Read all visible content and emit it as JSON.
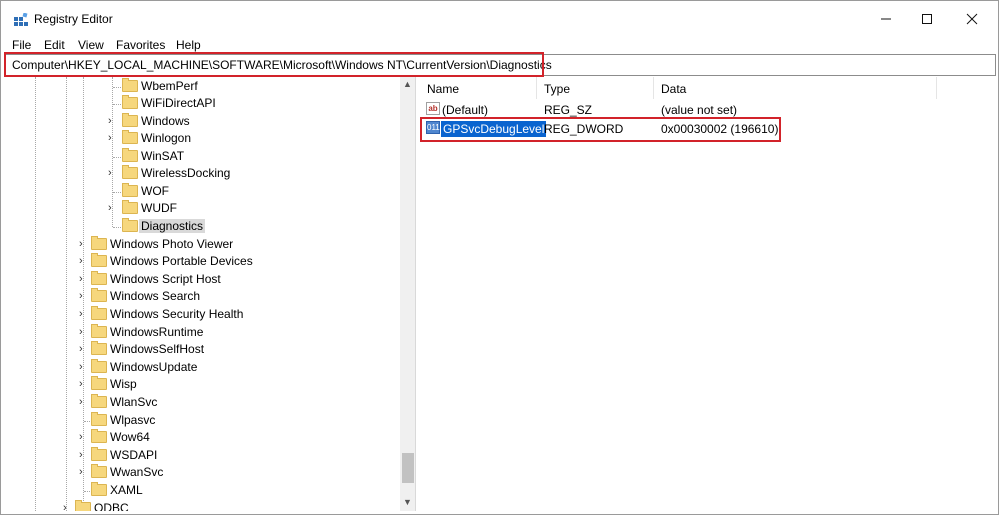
{
  "window": {
    "title": "Registry Editor"
  },
  "title_controls": {
    "minimize": "—",
    "maximize": "☐",
    "close": "✕"
  },
  "menu": [
    "File",
    "Edit",
    "View",
    "Favorites",
    "Help"
  ],
  "address": "Computer\\HKEY_LOCAL_MACHINE\\SOFTWARE\\Microsoft\\Windows NT\\CurrentVersion\\Diagnostics",
  "tree_items": [
    {
      "label": "WbemPerf",
      "expandable": false
    },
    {
      "label": "WiFiDirectAPI",
      "expandable": false
    },
    {
      "label": "Windows",
      "expandable": true
    },
    {
      "label": "Winlogon",
      "expandable": true
    },
    {
      "label": "WinSAT",
      "expandable": false
    },
    {
      "label": "WirelessDocking",
      "expandable": true
    },
    {
      "label": "WOF",
      "expandable": false
    },
    {
      "label": "WUDF",
      "expandable": true
    },
    {
      "label": "Diagnostics",
      "expandable": false,
      "selected": true
    },
    {
      "label": "Windows Photo Viewer",
      "expandable": true
    },
    {
      "label": "Windows Portable Devices",
      "expandable": true
    },
    {
      "label": "Windows Script Host",
      "expandable": true
    },
    {
      "label": "Windows Search",
      "expandable": true
    },
    {
      "label": "Windows Security Health",
      "expandable": true
    },
    {
      "label": "WindowsRuntime",
      "expandable": true
    },
    {
      "label": "WindowsSelfHost",
      "expandable": true
    },
    {
      "label": "WindowsUpdate",
      "expandable": true
    },
    {
      "label": "Wisp",
      "expandable": true
    },
    {
      "label": "WlanSvc",
      "expandable": true
    },
    {
      "label": "Wlpasvc",
      "expandable": false
    },
    {
      "label": "Wow64",
      "expandable": true
    },
    {
      "label": "WSDAPI",
      "expandable": true
    },
    {
      "label": "WwanSvc",
      "expandable": true
    },
    {
      "label": "XAML",
      "expandable": false
    },
    {
      "label": "ODBC",
      "expandable": true
    }
  ],
  "columns": [
    "Name",
    "Type",
    "Data"
  ],
  "values": [
    {
      "name": "(Default)",
      "type": "REG_SZ",
      "data": "(value not set)",
      "icon": "string-value-icon"
    },
    {
      "name": "GPSvcDebugLevel",
      "type": "REG_DWORD",
      "data": "0x00030002 (196610)",
      "icon": "binary-value-icon",
      "selected": true
    }
  ],
  "icons": {
    "string": "ab",
    "binary": "011"
  },
  "colors": {
    "highlight_red": "#d2232a",
    "selection_blue": "#0a64cf",
    "folder_yellow": "#f6d77d"
  }
}
